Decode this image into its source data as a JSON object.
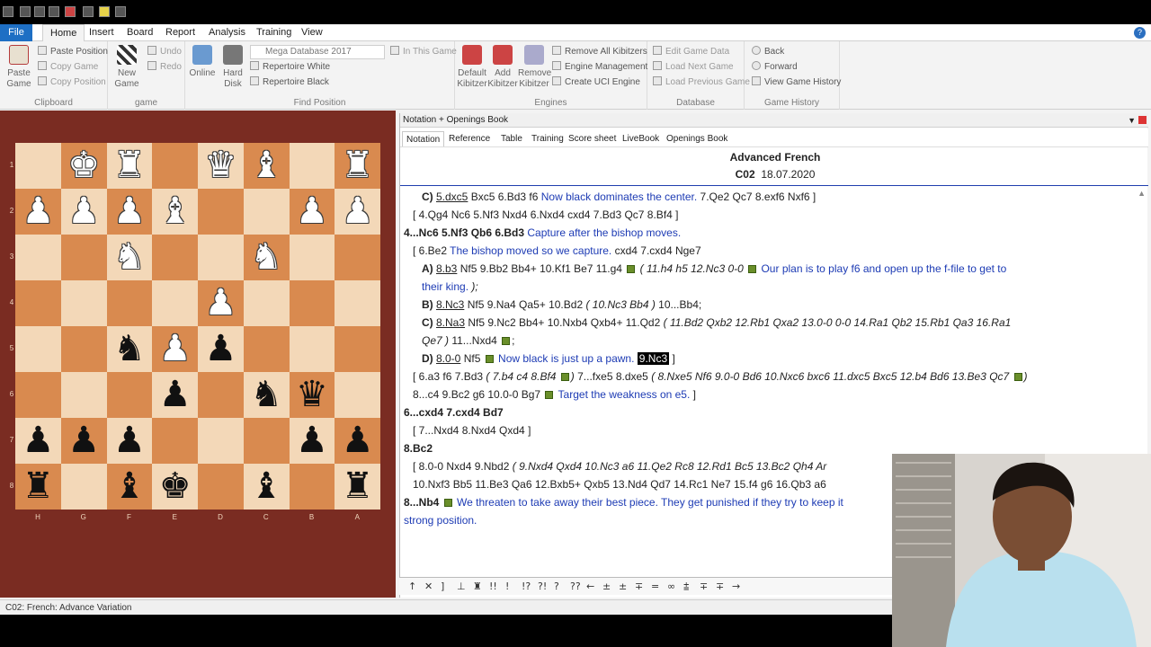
{
  "ribbon_tabs": [
    "File",
    "Home",
    "Insert",
    "Board",
    "Report",
    "Analysis",
    "Training",
    "View"
  ],
  "active_tab": "Home",
  "clipboard": {
    "paste_game": "Paste Game",
    "paste_position": "Paste Position",
    "copy_game": "Copy Game",
    "copy_position": "Copy Position",
    "label": "Clipboard"
  },
  "game_group": {
    "new_game": "New Game",
    "undo": "Undo",
    "redo": "Redo",
    "label": "game"
  },
  "find_position": {
    "online": "Online",
    "hard_disk": "Hard Disk",
    "database_select": "Mega Database 2017",
    "in_this_game": "In This Game",
    "repertoire_white": "Repertoire White",
    "repertoire_black": "Repertoire Black",
    "label": "Find Position"
  },
  "engines": {
    "default_kibitzer": "Default Kibitzer",
    "add_kibitzer": "Add Kibitzer",
    "remove_kibitzer": "Remove Kibitzer",
    "remove_all_kibitzers": "Remove All Kibitzers",
    "engine_management": "Engine Management",
    "create_uci_engine": "Create UCI Engine",
    "label": "Engines"
  },
  "database": {
    "edit_game_data": "Edit Game Data",
    "load_next_game": "Load Next Game",
    "load_previous_game": "Load Previous Game",
    "label": "Database"
  },
  "game_history": {
    "back": "Back",
    "forward": "Forward",
    "view_game_history": "View Game History",
    "label": "Game History"
  },
  "board": {
    "ranks": [
      "1",
      "2",
      "3",
      "4",
      "5",
      "6",
      "7",
      "8"
    ],
    "files": [
      "H",
      "G",
      "F",
      "E",
      "D",
      "C",
      "B",
      "A"
    ],
    "pieces": [
      {
        "name": "white-king",
        "glyph": "♚",
        "color": "w",
        "row": 0,
        "col": 1
      },
      {
        "name": "white-rook",
        "glyph": "♜",
        "color": "w",
        "row": 0,
        "col": 2
      },
      {
        "name": "white-queen",
        "glyph": "♛",
        "color": "w",
        "row": 0,
        "col": 4
      },
      {
        "name": "white-bishop",
        "glyph": "♝",
        "color": "w",
        "row": 0,
        "col": 5
      },
      {
        "name": "white-rook",
        "glyph": "♜",
        "color": "w",
        "row": 0,
        "col": 7
      },
      {
        "name": "white-pawn",
        "glyph": "♟",
        "color": "w",
        "row": 1,
        "col": 0
      },
      {
        "name": "white-pawn",
        "glyph": "♟",
        "color": "w",
        "row": 1,
        "col": 1
      },
      {
        "name": "white-pawn",
        "glyph": "♟",
        "color": "w",
        "row": 1,
        "col": 2
      },
      {
        "name": "white-bishop",
        "glyph": "♝",
        "color": "w",
        "row": 1,
        "col": 3
      },
      {
        "name": "white-pawn",
        "glyph": "♟",
        "color": "w",
        "row": 1,
        "col": 6
      },
      {
        "name": "white-pawn",
        "glyph": "♟",
        "color": "w",
        "row": 1,
        "col": 7
      },
      {
        "name": "white-knight",
        "glyph": "♞",
        "color": "w",
        "row": 2,
        "col": 2
      },
      {
        "name": "white-knight",
        "glyph": "♞",
        "color": "w",
        "row": 2,
        "col": 5
      },
      {
        "name": "white-pawn",
        "glyph": "♟",
        "color": "w",
        "row": 3,
        "col": 4
      },
      {
        "name": "black-knight",
        "glyph": "♞",
        "color": "b",
        "row": 4,
        "col": 2
      },
      {
        "name": "white-pawn",
        "glyph": "♟",
        "color": "w",
        "row": 4,
        "col": 3
      },
      {
        "name": "black-pawn",
        "glyph": "♟",
        "color": "b",
        "row": 4,
        "col": 4
      },
      {
        "name": "black-pawn",
        "glyph": "♟",
        "color": "b",
        "row": 5,
        "col": 3
      },
      {
        "name": "black-knight",
        "glyph": "♞",
        "color": "b",
        "row": 5,
        "col": 5
      },
      {
        "name": "black-queen",
        "glyph": "♛",
        "color": "b",
        "row": 5,
        "col": 6
      },
      {
        "name": "black-pawn",
        "glyph": "♟",
        "color": "b",
        "row": 6,
        "col": 0
      },
      {
        "name": "black-pawn",
        "glyph": "♟",
        "color": "b",
        "row": 6,
        "col": 1
      },
      {
        "name": "black-pawn",
        "glyph": "♟",
        "color": "b",
        "row": 6,
        "col": 2
      },
      {
        "name": "black-pawn",
        "glyph": "♟",
        "color": "b",
        "row": 6,
        "col": 6
      },
      {
        "name": "black-pawn",
        "glyph": "♟",
        "color": "b",
        "row": 6,
        "col": 7
      },
      {
        "name": "black-rook",
        "glyph": "♜",
        "color": "b",
        "row": 7,
        "col": 0
      },
      {
        "name": "black-bishop",
        "glyph": "♝",
        "color": "b",
        "row": 7,
        "col": 2
      },
      {
        "name": "black-king",
        "glyph": "♚",
        "color": "b",
        "row": 7,
        "col": 3
      },
      {
        "name": "black-bishop",
        "glyph": "♝",
        "color": "b",
        "row": 7,
        "col": 5
      },
      {
        "name": "black-rook",
        "glyph": "♜",
        "color": "b",
        "row": 7,
        "col": 7
      }
    ]
  },
  "notation_panel": {
    "header": "Notation + Openings Book",
    "tabs": [
      "Notation",
      "Reference",
      "Table",
      "Training",
      "Score sheet",
      "LiveBook",
      "Openings Book"
    ],
    "active_tab": "Notation",
    "game_title": "Advanced French",
    "eco": "C02",
    "date": "18.07.2020"
  },
  "moves": [
    {
      "indent": "i2",
      "parts": [
        [
          "mb",
          "C) "
        ],
        [
          "u",
          "5.dxc5"
        ],
        [
          "",
          " Bxc5 6.Bd3 f6 "
        ],
        [
          "cm",
          "Now black dominates the center."
        ],
        [
          "",
          " 7.Qe2 Qc7 8.exf6 Nxf6 ]"
        ]
      ]
    },
    {
      "indent": "i1",
      "parts": [
        [
          "",
          "[ 4.Qg4 Nc6 5.Nf3 Nxd4 6.Nxd4 cxd4 7.Bd3 Qc7 8.Bf4 ]"
        ]
      ]
    },
    {
      "indent": "",
      "parts": [
        [
          "mb",
          "4...Nc6 5.Nf3 Qb6 6.Bd3 "
        ],
        [
          "cm",
          "Capture after the bishop moves."
        ]
      ]
    },
    {
      "indent": "i1",
      "parts": [
        [
          "",
          "[ 6.Be2 "
        ],
        [
          "cm",
          "The bishop moved so we capture."
        ],
        [
          "",
          " cxd4 7.cxd4 Nge7"
        ]
      ]
    },
    {
      "indent": "i2",
      "parts": [
        [
          "mb",
          "A) "
        ],
        [
          "u",
          "8.b3"
        ],
        [
          "",
          " Nf5 9.Bb2 Bb4+ 10.Kf1 Be7 11.g4 "
        ],
        [
          "flag",
          ""
        ],
        [
          "vr",
          " ( 11.h4 h5 12.Nc3 0-0 "
        ],
        [
          "flag",
          ""
        ],
        [
          "cm",
          " Our plan is to play f6 and open up the f-file to get to"
        ]
      ]
    },
    {
      "indent": "i2",
      "parts": [
        [
          "cm",
          "their king."
        ],
        [
          "vr",
          " );"
        ]
      ]
    },
    {
      "indent": "i2",
      "parts": [
        [
          "mb",
          "B) "
        ],
        [
          "u",
          "8.Nc3"
        ],
        [
          "",
          " Nf5 9.Na4 Qa5+ 10.Bd2 "
        ],
        [
          "vr",
          "( 10.Nc3 Bb4 )"
        ],
        [
          "",
          " 10...Bb4;"
        ]
      ]
    },
    {
      "indent": "i2",
      "parts": [
        [
          "mb",
          "C) "
        ],
        [
          "u",
          "8.Na3"
        ],
        [
          "",
          " Nf5 9.Nc2 Bb4+ 10.Nxb4 Qxb4+ 11.Qd2 "
        ],
        [
          "vr",
          "( 11.Bd2 Qxb2 12.Rb1 Qxa2 13.0-0 0-0 14.Ra1 Qb2 15.Rb1 Qa3 16.Ra1"
        ]
      ]
    },
    {
      "indent": "i2",
      "parts": [
        [
          "vr",
          "Qe7 )"
        ],
        [
          "",
          " 11...Nxd4 "
        ],
        [
          "flag",
          ""
        ],
        [
          "",
          ";"
        ]
      ]
    },
    {
      "indent": "i2",
      "parts": [
        [
          "mb",
          "D) "
        ],
        [
          "u",
          "8.0-0"
        ],
        [
          "",
          " Nf5 "
        ],
        [
          "flag",
          ""
        ],
        [
          "cm",
          " Now black is just up a pawn."
        ],
        [
          "",
          " "
        ],
        [
          "hl",
          "9.Nc3"
        ],
        [
          "",
          " ]"
        ]
      ]
    },
    {
      "indent": "i1",
      "parts": [
        [
          "",
          "[ 6.a3 f6 7.Bd3 "
        ],
        [
          "vr",
          "( 7.b4 c4 8.Bf4 "
        ],
        [
          "flag",
          ""
        ],
        [
          "vr",
          ")"
        ],
        [
          "",
          " 7...fxe5 8.dxe5 "
        ],
        [
          "vr",
          "( 8.Nxe5 Nf6 9.0-0 Bd6 10.Nxc6 bxc6 11.dxc5 Bxc5 12.b4 Bd6 13.Be3 Qc7 "
        ],
        [
          "flag",
          ""
        ],
        [
          "vr",
          ")"
        ]
      ]
    },
    {
      "indent": "i1",
      "parts": [
        [
          "",
          "8...c4 9.Bc2 g6 10.0-0 Bg7 "
        ],
        [
          "flag",
          ""
        ],
        [
          "cm",
          " Target the weakness on e5."
        ],
        [
          "",
          " ]"
        ]
      ]
    },
    {
      "indent": "",
      "parts": [
        [
          "mb",
          "6...cxd4 7.cxd4 Bd7"
        ]
      ]
    },
    {
      "indent": "i1",
      "parts": [
        [
          "",
          "[ 7...Nxd4 8.Nxd4 Qxd4 ]"
        ]
      ]
    },
    {
      "indent": "",
      "parts": [
        [
          "mb",
          "8.Bc2"
        ]
      ]
    },
    {
      "indent": "i1",
      "parts": [
        [
          "",
          "[ 8.0-0 Nxd4 9.Nbd2 "
        ],
        [
          "vr",
          "( 9.Nxd4 Qxd4 10.Nc3 a6 11.Qe2 Rc8 12.Rd1 Bc5 13.Bc2 Qh4 Ar"
        ]
      ]
    },
    {
      "indent": "i1",
      "parts": [
        [
          "",
          "10.Nxf3 Bb5 11.Be3 Qa6 12.Bxb5+ Qxb5 13.Nd4 Qd7 14.Rc1 Ne7 15.f4 g6 16.Qb3 a6"
        ]
      ]
    },
    {
      "indent": "",
      "parts": [
        [
          "mb",
          "8...Nb4 "
        ],
        [
          "flag",
          ""
        ],
        [
          "cm",
          " We threaten to take away their best piece. They get punished if they try to keep it"
        ]
      ]
    },
    {
      "indent": "",
      "parts": [
        [
          "cm",
          "strong position."
        ]
      ]
    }
  ],
  "symbols": [
    "↑",
    "✕",
    "]",
    "⊥",
    "♜",
    "!!",
    "!",
    "!?",
    "?!",
    "?",
    "??",
    "←",
    "±",
    "±",
    "∓",
    "=",
    "∞",
    "⩲",
    "∓",
    "∓",
    "→"
  ],
  "status_text": "C02: French: Advance Variation"
}
